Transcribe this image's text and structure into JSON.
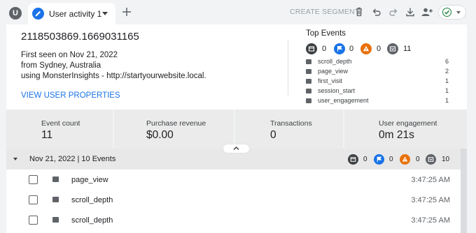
{
  "tabbar": {
    "avatar_initial": "U",
    "tab_label": "User activity 1",
    "create_segment_label": "CREATE SEGMENT"
  },
  "user": {
    "id": "2118503869.1669031165",
    "first_seen": "First seen on Nov 21, 2022",
    "location": "from Sydney, Australia",
    "using": "using MonsterInsights - http://startyourwebsite.local.",
    "view_properties_label": "VIEW USER PROPERTIES"
  },
  "top_events": {
    "title": "Top Events",
    "categories": [
      {
        "icon": "page-icon",
        "color": "#3c4043",
        "count": "0"
      },
      {
        "icon": "flag-icon",
        "color": "#1a73e8",
        "count": "0"
      },
      {
        "icon": "warning-icon",
        "color": "#e8710a",
        "count": "0"
      },
      {
        "icon": "event-icon",
        "color": "#5f6368",
        "count": "11"
      }
    ],
    "events": [
      {
        "name": "scroll_depth",
        "count": "6"
      },
      {
        "name": "page_view",
        "count": "2"
      },
      {
        "name": "first_visit",
        "count": "1"
      },
      {
        "name": "session_start",
        "count": "1"
      },
      {
        "name": "user_engagement",
        "count": "1"
      }
    ]
  },
  "stats": [
    {
      "label": "Event count",
      "value": "11"
    },
    {
      "label": "Purchase revenue",
      "value": "$0.00"
    },
    {
      "label": "Transactions",
      "value": "0"
    },
    {
      "label": "User engagement",
      "value": "0m 21s"
    }
  ],
  "timeline": {
    "date_label": "Nov 21, 2022 | 10 Events",
    "category_counts": [
      "0",
      "0",
      "0",
      "10"
    ],
    "events": [
      {
        "name": "page_view",
        "time": "3:47:25 AM"
      },
      {
        "name": "scroll_depth",
        "time": "3:47:25 AM"
      },
      {
        "name": "scroll_depth",
        "time": "3:47:25 AM"
      }
    ]
  },
  "colors": {
    "accent": "#1a73e8",
    "success": "#188038",
    "warning": "#e8710a"
  }
}
